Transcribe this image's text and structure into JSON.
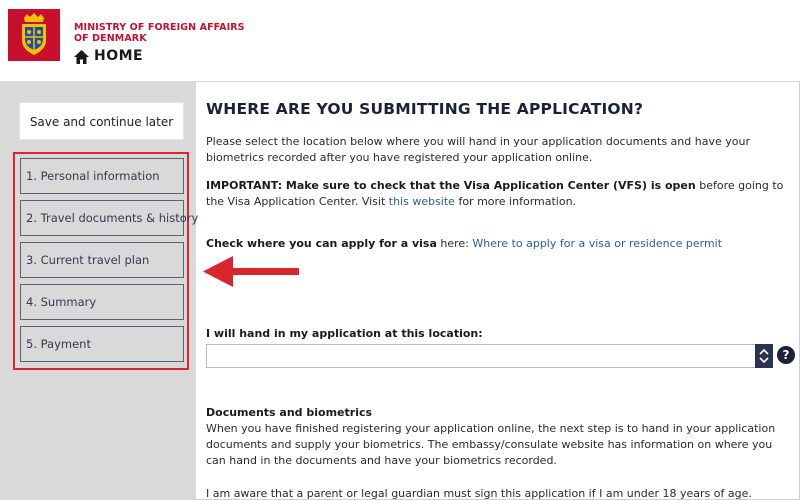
{
  "header": {
    "ministry_line1": "MINISTRY OF FOREIGN AFFAIRS",
    "ministry_line2": "OF DENMARK",
    "home_label": "HOME",
    "brand_color": "#c8102e"
  },
  "sidebar": {
    "save_label": "Save and continue later",
    "highlight_color": "#e0232e",
    "steps": [
      {
        "label": "1. Personal information"
      },
      {
        "label": "2. Travel documents & history"
      },
      {
        "label": "3. Current travel plan"
      },
      {
        "label": "4. Summary"
      },
      {
        "label": "5. Payment"
      }
    ]
  },
  "main": {
    "title": "WHERE ARE YOU SUBMITTING THE APPLICATION?",
    "intro": "Please select the location below where you will hand in your application documents and have your biometrics recorded after you have registered your application online.",
    "important_bold": "IMPORTANT: Make sure to check that the Visa Application Center (VFS) is open",
    "important_rest": " before going to the Visa Application Center. Visit ",
    "important_link": "this website",
    "important_tail": " for more information.",
    "check_bold": "Check where you can apply for a visa",
    "check_rest": " here: ",
    "check_link": "Where to apply for a visa or residence permit",
    "location_label": "I will hand in my application at this location:",
    "location_value": "",
    "help_glyph": "?",
    "docs_heading": "Documents and biometrics",
    "docs_text": "When you have finished registering your application online, the next step is to hand in your application documents and supply your biometrics. The embassy/consulate website has information on where you can hand in the documents and have your biometrics recorded.",
    "guardian_text": "I am aware that a parent or legal guardian must sign this application if I am under 18 years of age."
  },
  "icons": {
    "crest": "royal-coat-of-arms-icon",
    "home": "house-icon",
    "arrow": "left-arrow-icon",
    "select": "up-down-chevron-icon",
    "help": "question-mark-icon"
  }
}
